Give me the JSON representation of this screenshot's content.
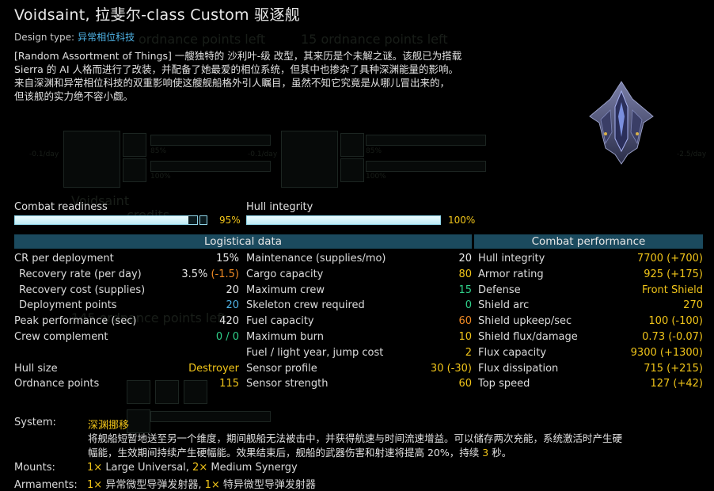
{
  "header": {
    "title": "Voidsaint, 拉斐尔-class Custom 驱逐舰",
    "design_type_label": "Design type:",
    "design_type_value": "异常相位科技"
  },
  "description": [
    "[Random Assortment of Things] 一艘独特的 沙利叶-级 改型，其来历是个未解之谜。该舰已为搭载",
    "Sierra 的 AI 人格而进行了改装，并配备了她最爱的相位系统，但其中也掺杂了具种深渊能量的影响。",
    "来自深渊和异常相位科技的双重影响使这艘舰船格外引人瞩目，虽然不知它究竟是从哪儿冒出来的，",
    "但该舰的实力绝不容小觑。"
  ],
  "background_ghost": {
    "points_left_1": "ordnance points left",
    "points_left_2": "15 ordnance points left",
    "name": "Voidsaint",
    "credits": "credits",
    "points_left_3": "145 ordnance points left",
    "pct1": "85%",
    "pct2": "100%",
    "perday1": "-0.1/day",
    "perday2": "-2.5/day"
  },
  "bars": {
    "combat_readiness": {
      "label": "Combat readiness",
      "percent_text": "95%",
      "value": 0.95
    },
    "hull_integrity": {
      "label": "Hull integrity",
      "percent_text": "100%",
      "value": 1.0
    }
  },
  "sections": {
    "logistical_title": "Logistical data",
    "combat_title": "Combat performance"
  },
  "logistics_col1": [
    {
      "label": "CR per deployment",
      "value": "15%",
      "color": "w"
    },
    {
      "label": "Recovery rate (per day)",
      "value": "3.5%",
      "value_extra": "(-1.5)",
      "color": "w",
      "extra_color": "o",
      "indent": true
    },
    {
      "label": "Recovery cost (supplies)",
      "value": "20",
      "color": "w",
      "indent": true
    },
    {
      "label": "Deployment points",
      "value": "20",
      "color": "c",
      "indent": true
    },
    {
      "label": "Peak performance (sec)",
      "value": "420",
      "color": "w"
    },
    {
      "label": "Crew complement",
      "value": "0 / 0",
      "color": "g"
    },
    {
      "label": "",
      "value": "",
      "color": "w"
    },
    {
      "label": "Hull size",
      "value": "Destroyer",
      "color": "y"
    },
    {
      "label": "Ordnance points",
      "value": "115",
      "color": "y"
    }
  ],
  "logistics_col2": [
    {
      "label": "Maintenance (supplies/mo)",
      "value": "20",
      "color": "w"
    },
    {
      "label": "Cargo capacity",
      "value": "80",
      "color": "y"
    },
    {
      "label": "Maximum crew",
      "value": "15",
      "color": "g"
    },
    {
      "label": "Skeleton crew required",
      "value": "0",
      "color": "g"
    },
    {
      "label": "Fuel capacity",
      "value": "60",
      "color": "o"
    },
    {
      "label": "Maximum burn",
      "value": "10",
      "color": "y"
    },
    {
      "label": "Fuel / light year, jump cost",
      "value": "2",
      "color": "y"
    },
    {
      "label": "Sensor profile",
      "value": "30",
      "value_extra": "(-30)",
      "color": "y",
      "extra_color": "y"
    },
    {
      "label": "Sensor strength",
      "value": "60",
      "color": "y"
    }
  ],
  "combat": [
    {
      "label": "Hull integrity",
      "value": "7700 (+700)",
      "color": "y"
    },
    {
      "label": "Armor rating",
      "value": "925 (+175)",
      "color": "y"
    },
    {
      "label": "Defense",
      "value": "Front Shield",
      "color": "y"
    },
    {
      "label": "Shield arc",
      "value": "270",
      "color": "y"
    },
    {
      "label": "Shield upkeep/sec",
      "value": "100 (-100)",
      "color": "y"
    },
    {
      "label": "Shield flux/damage",
      "value": "0.73 (-0.07)",
      "color": "y"
    },
    {
      "label": "Flux capacity",
      "value": "9300 (+1300)",
      "color": "y"
    },
    {
      "label": "Flux dissipation",
      "value": "715 (+215)",
      "color": "y"
    },
    {
      "label": "Top speed",
      "value": "127 (+42)",
      "color": "y"
    }
  ],
  "system": {
    "label": "System:",
    "name": "深渊挪移",
    "desc_1": "将舰船短暂地送至另一个维度，期间舰船无法被击中，并获得航速与时间流速增益。可以储存两次充能，系统激活时产生硬",
    "desc_2a": "幅能，生效期间持续产生硬幅能。效果结束后，舰船的武器伤害和射速将提高 20%，持续",
    "desc_2b": "3",
    "desc_2c": "秒。"
  },
  "mounts": {
    "label": "Mounts:",
    "m1": "1×",
    "t1": "Large Universal,",
    "m2": "2×",
    "t2": "Medium Synergy"
  },
  "armaments": {
    "label": "Armaments:",
    "m1": "1×",
    "t1": "异常微型导弹发射器,",
    "m2": "1×",
    "t2": "特异微型导弹发射器"
  }
}
